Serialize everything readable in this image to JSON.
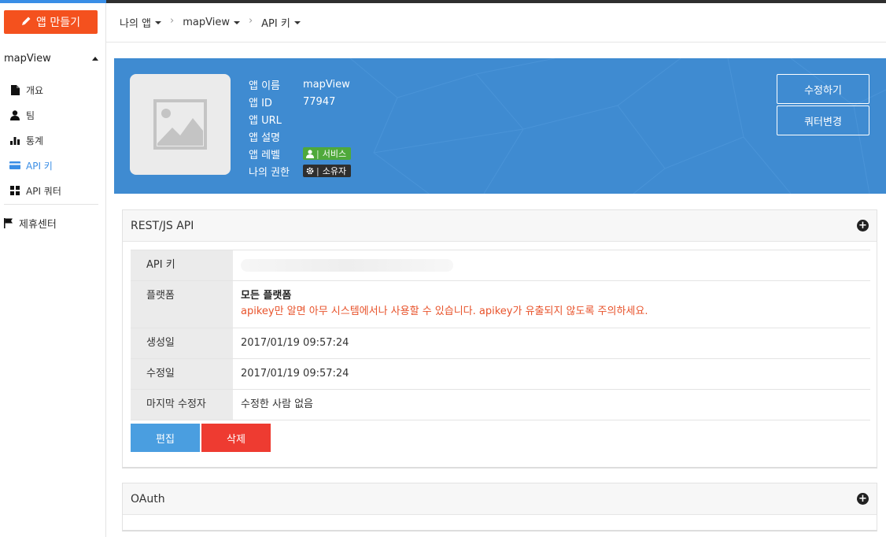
{
  "sidebar": {
    "make_app": "앱 만들기",
    "app_name": "mapView",
    "menu": [
      {
        "label": "개요",
        "icon": "document-icon"
      },
      {
        "label": "팀",
        "icon": "user-icon"
      },
      {
        "label": "통계",
        "icon": "bar-chart-icon"
      },
      {
        "label": "API 키",
        "icon": "card-icon"
      },
      {
        "label": "API 쿼터",
        "icon": "grid-icon"
      }
    ],
    "partner": "제휴센터"
  },
  "breadcrumb": [
    "나의 앱",
    "mapView",
    "API 키"
  ],
  "app_info": {
    "labels": [
      "앱 이름",
      "앱 ID",
      "앱 URL",
      "앱 설명",
      "앱 레벨",
      "나의 권한"
    ],
    "name": "mapView",
    "id": "77947",
    "url": "",
    "description": "",
    "level": "서비스",
    "role": "소유자"
  },
  "header_buttons": {
    "edit": "수정하기",
    "quota": "쿼터변경"
  },
  "rest_panel": {
    "title": "REST/JS API",
    "rows": {
      "api_key_label": "API 키",
      "platform_label": "플랫폼",
      "platform_value": "모든 플랫폼",
      "platform_warning": "apikey만 알면 아무 시스템에서나 사용할 수 있습니다. apikey가 유출되지 않도록 주의하세요.",
      "created_label": "생성일",
      "created_value": "2017/01/19 09:57:24",
      "modified_label": "수정일",
      "modified_value": "2017/01/19 09:57:24",
      "last_editor_label": "마지막 수정자",
      "last_editor_value": "수정한 사람 없음"
    },
    "edit_button": "편집",
    "delete_button": "삭제"
  },
  "oauth_panel": {
    "title": "OAuth"
  },
  "colors": {
    "make_button": "#f4511e",
    "header_bg": "#3f8bd1",
    "active_menu": "#3a8ee6",
    "level_badge": "#4fa93a",
    "role_badge": "#2e2e2e",
    "edit_button": "#4a9ee0",
    "delete_button": "#ee3b31",
    "warning_text": "#e8532b"
  }
}
